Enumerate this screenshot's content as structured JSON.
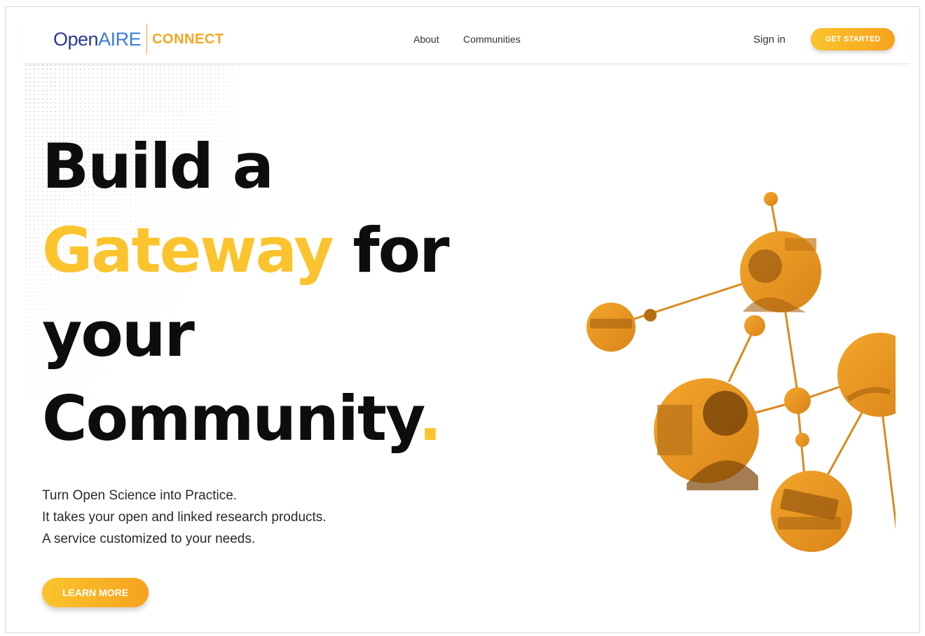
{
  "header": {
    "logo": {
      "part1": "Open",
      "part2": "AIRE",
      "part3": "CONNECT"
    },
    "nav": {
      "about": "About",
      "communities": "Communities"
    },
    "sign_in": "Sign in",
    "cta": "GET STARTED"
  },
  "hero": {
    "line1": "Build a",
    "line2_highlight": "Gateway",
    "line2_rest": "for",
    "line3": "your",
    "line4": "Community",
    "line4_end": ".",
    "sub1": "Turn Open Science into Practice.",
    "sub2": "It takes your open and linked research products.",
    "sub3": "A service customized to your needs.",
    "button": "LEARN MORE"
  },
  "colors": {
    "accent": "#fbc42e",
    "accent_dark": "#f6a21d",
    "brand_blue": "#2b3a8f",
    "photo_tint": "#e8961e"
  },
  "illustration": "network-of-people-icon"
}
